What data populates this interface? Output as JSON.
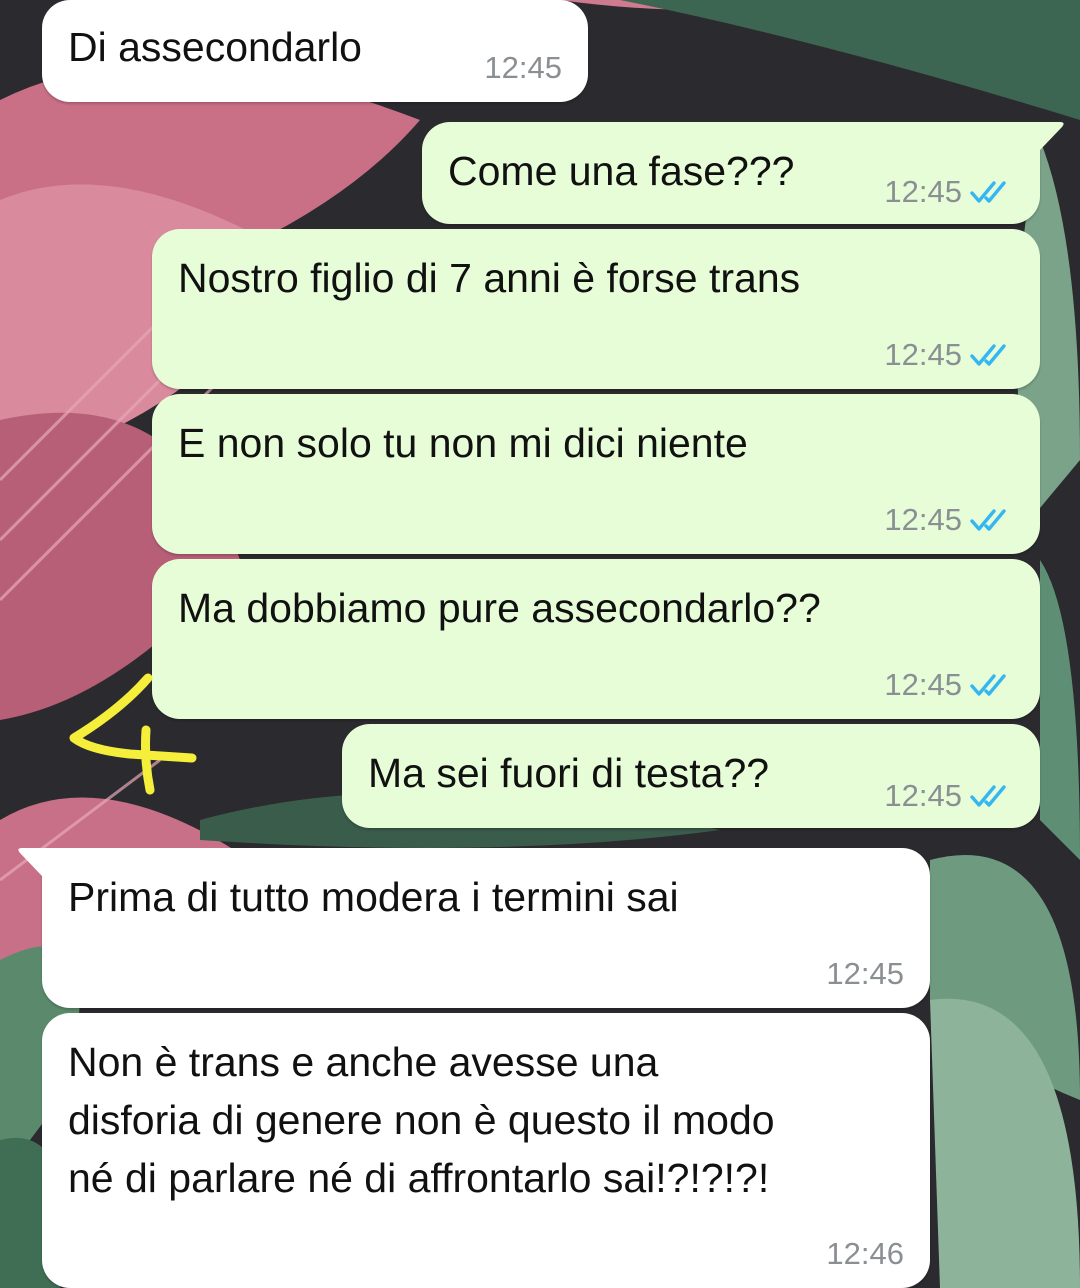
{
  "messages": [
    {
      "direction": "in",
      "text": "Di assecondarlo",
      "time": "12:45"
    },
    {
      "direction": "out",
      "text": "Come una fase???",
      "time": "12:45",
      "read_receipt": "double-check-read"
    },
    {
      "direction": "out",
      "text": "Nostro figlio di 7 anni è forse trans",
      "time": "12:45",
      "read_receipt": "double-check-read"
    },
    {
      "direction": "out",
      "text": "E non solo tu non mi dici niente",
      "time": "12:45",
      "read_receipt": "double-check-read"
    },
    {
      "direction": "out",
      "text": "Ma dobbiamo pure assecondarlo??",
      "time": "12:45",
      "read_receipt": "double-check-read"
    },
    {
      "direction": "out",
      "text": "Ma sei fuori di testa??",
      "time": "12:45",
      "read_receipt": "double-check-read"
    },
    {
      "direction": "in",
      "text": "Prima di tutto modera i termini sai",
      "time": "12:45"
    },
    {
      "direction": "in",
      "text": "Non è trans e anche avesse una\ndisforia di genere non è questo il modo\nné di parlare né di affrontarlo sai!?!?!?!",
      "time": "12:46"
    }
  ],
  "annotation": {
    "text": "4",
    "color": "#f5ee3a"
  },
  "colors": {
    "incoming_bubble": "#ffffff",
    "outgoing_bubble": "#e7fdd8",
    "read_ticks": "#34b7f1",
    "timestamp": "#8a8f93"
  },
  "wallpaper": "tropical-leaves-pink-green"
}
